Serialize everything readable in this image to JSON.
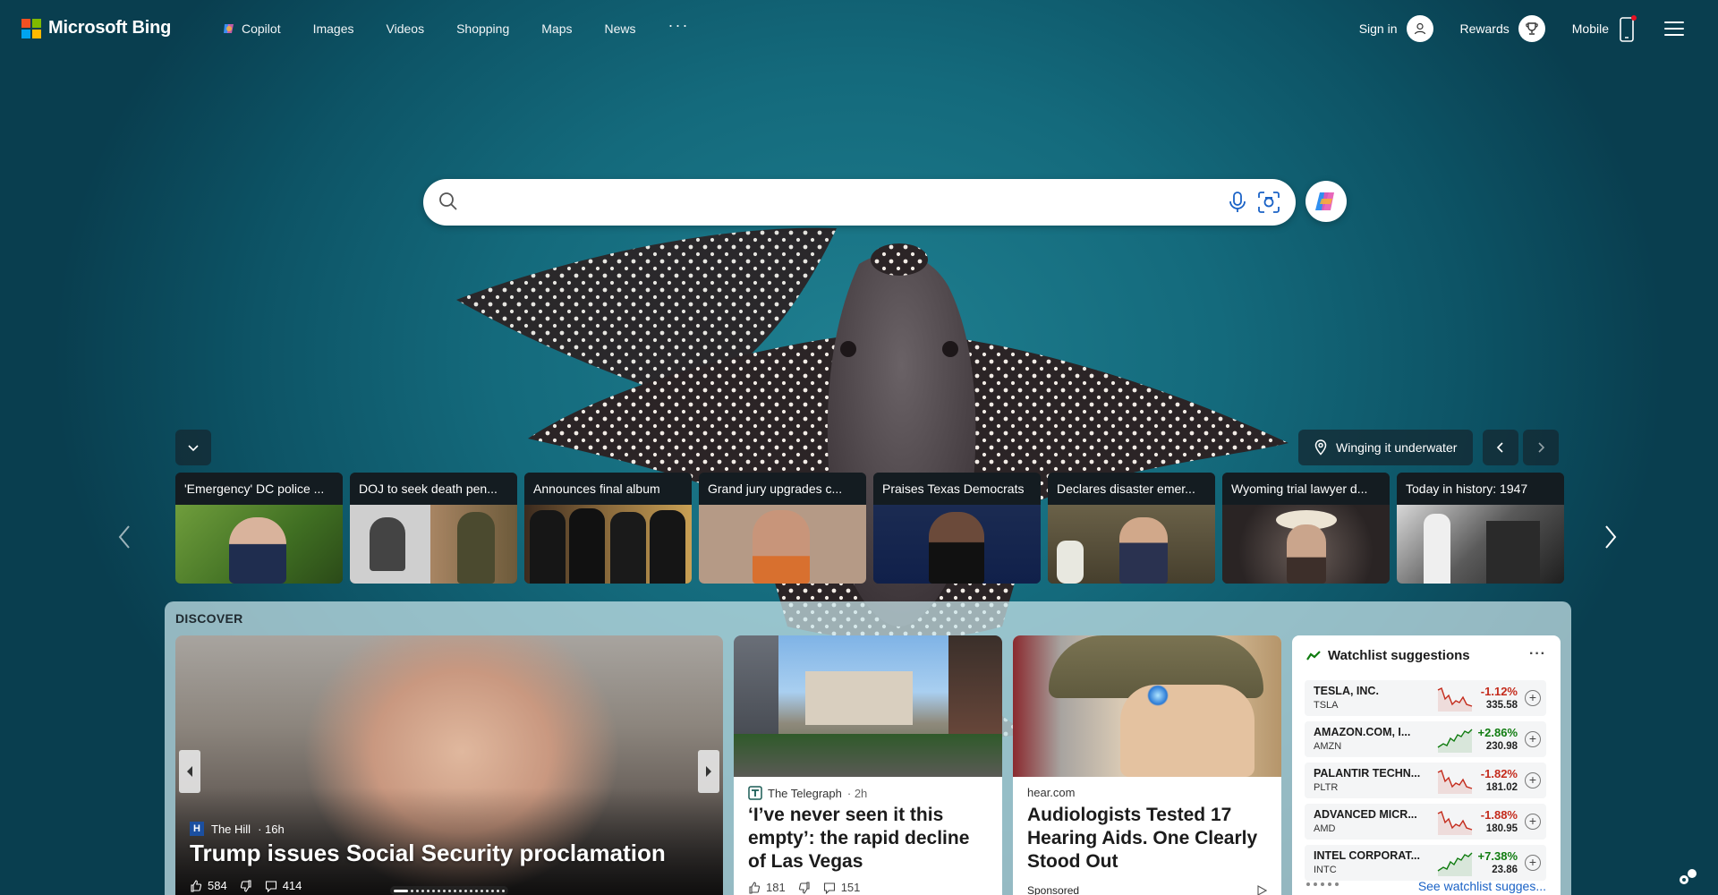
{
  "header": {
    "brand": "Microsoft Bing",
    "nav": [
      "Copilot",
      "Images",
      "Videos",
      "Shopping",
      "Maps",
      "News"
    ],
    "more": "···",
    "sign_in": "Sign in",
    "rewards": "Rewards",
    "mobile": "Mobile"
  },
  "search": {
    "value": "",
    "placeholder": ""
  },
  "image_info": {
    "title": "Winging it underwater"
  },
  "news_strip": [
    {
      "title": "'Emergency' DC police ..."
    },
    {
      "title": "DOJ to seek death pen..."
    },
    {
      "title": "Announces final album"
    },
    {
      "title": "Grand jury upgrades c..."
    },
    {
      "title": "Praises Texas Democrats"
    },
    {
      "title": "Declares disaster emer..."
    },
    {
      "title": "Wyoming trial lawyer d..."
    },
    {
      "title": "Today in history: 1947"
    }
  ],
  "discover": {
    "label": "DISCOVER",
    "hero": {
      "source": "The Hill",
      "age": "· 16h",
      "title": "Trump issues Social Security proclamation",
      "likes": "584",
      "comments": "414"
    },
    "card1": {
      "source": "The Telegraph",
      "age": "· 2h",
      "title": "‘I’ve never seen it this empty’: the rapid decline of Las Vegas",
      "likes": "181",
      "comments": "151"
    },
    "card2": {
      "source": "hear.com",
      "title": "Audiologists Tested 17 Hearing Aids. One Clearly Stood Out",
      "sponsored": "Sponsored"
    },
    "watchlist": {
      "title": "Watchlist suggestions",
      "more": "···",
      "stocks": [
        {
          "name": "TESLA, INC.",
          "symbol": "TSLA",
          "change": "-1.12%",
          "price": "335.58",
          "trend": "down"
        },
        {
          "name": "AMAZON.COM, I...",
          "symbol": "AMZN",
          "change": "+2.86%",
          "price": "230.98",
          "trend": "up"
        },
        {
          "name": "PALANTIR TECHN...",
          "symbol": "PLTR",
          "change": "-1.82%",
          "price": "181.02",
          "trend": "down"
        },
        {
          "name": "ADVANCED MICR...",
          "symbol": "AMD",
          "change": "-1.88%",
          "price": "180.95",
          "trend": "down"
        },
        {
          "name": "INTEL CORPORAT...",
          "symbol": "INTC",
          "change": "+7.38%",
          "price": "23.86",
          "trend": "up"
        }
      ],
      "link": "See watchlist sugges..."
    }
  },
  "colors": {
    "ms_red": "#f25022",
    "ms_green": "#7fba00",
    "ms_blue": "#00a4ef",
    "ms_yellow": "#ffb900",
    "negative": "#c42b1c",
    "positive": "#107c10",
    "link": "#1a62c6"
  }
}
